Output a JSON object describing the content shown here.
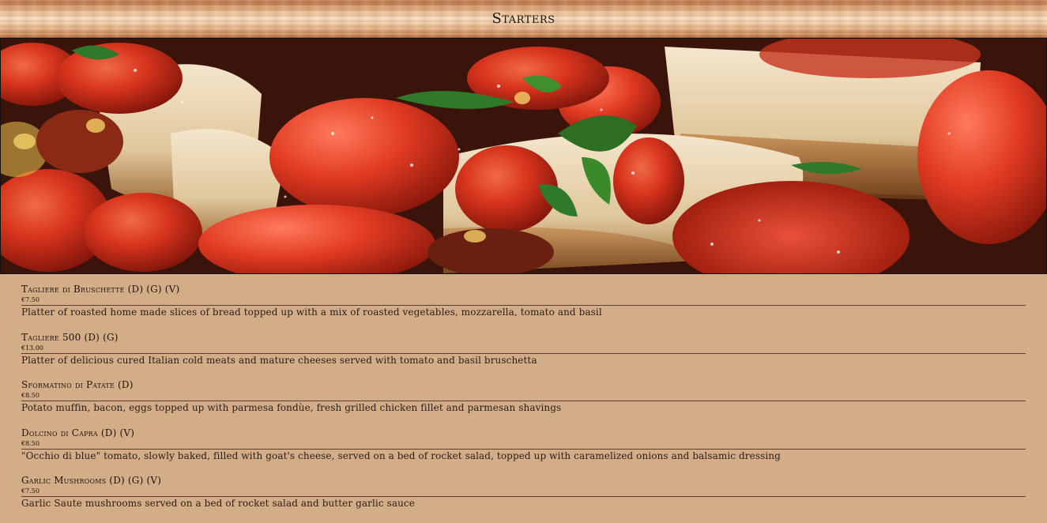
{
  "page": {
    "title": "Starters"
  },
  "hero": {
    "image_name": "bruschetta-photo"
  },
  "menu": {
    "items": [
      {
        "name": "Tagliere di Bruschette (D) (G) (V)",
        "price": "€7.50",
        "description": "Platter of roasted home made slices of bread topped up with a mix of roasted vegetables, mozzarella, tomato and basil"
      },
      {
        "name": "Tagliere 500 (D) (G)",
        "price": "€13.00",
        "description": "Platter of delicious cured Italian cold meats and mature cheeses served with tomato and basil bruschetta"
      },
      {
        "name": "Sformatino di Patate (D)",
        "price": "€8.50",
        "description": "Potato muffin, bacon, eggs topped up with parmesa fondùe, fresh grilled chicken fillet and parmesan shavings"
      },
      {
        "name": "Dolcino di Capra (D) (V)",
        "price": "€8.50",
        "description": "\"Occhio di blue\" tomato, slowly baked, filled with goat's cheese, served on a bed of rocket salad, topped up with caramelized onions and balsamic dressing"
      },
      {
        "name": "Garlic Mushrooms (D) (G) (V)",
        "price": "€7.50",
        "description": "Garlic Saute mushrooms served on a bed of rocket salad and butter garlic sauce"
      }
    ]
  },
  "colors": {
    "background": "#d3ac88",
    "header_light": "#f6dcc0",
    "header_dark": "#b2693a",
    "text": "#1e140c",
    "divider": "#5a4030"
  }
}
